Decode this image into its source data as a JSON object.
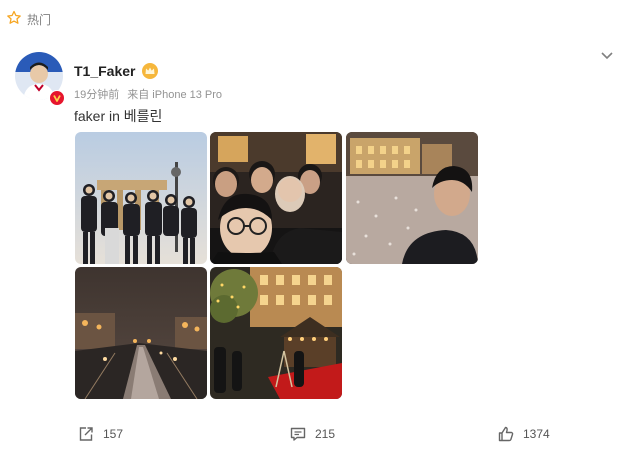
{
  "header": {
    "section_label": "热门"
  },
  "post": {
    "author": "T1_Faker",
    "time": "19分钟前",
    "source": "来自 iPhone 13 Pro",
    "text": "faker in 베를린",
    "photos": [
      {
        "scene": "group-at-brandenburg-gate"
      },
      {
        "scene": "night-selfie-group"
      },
      {
        "scene": "selfie-at-snowy-palace"
      },
      {
        "scene": "night-boulevard-rain"
      },
      {
        "scene": "christmas-market-night"
      }
    ]
  },
  "actions": {
    "repost_count": "157",
    "comment_count": "215",
    "like_count": "1374"
  },
  "colors": {
    "accent": "#ff8200",
    "vip_gold": "#f6b73c",
    "verified_red": "#e6162d",
    "muted": "#939393"
  },
  "icons": [
    "fire-icon",
    "chevron-down-icon",
    "verified-icon",
    "vip-crown-icon",
    "repost-icon",
    "comment-icon",
    "like-icon"
  ]
}
